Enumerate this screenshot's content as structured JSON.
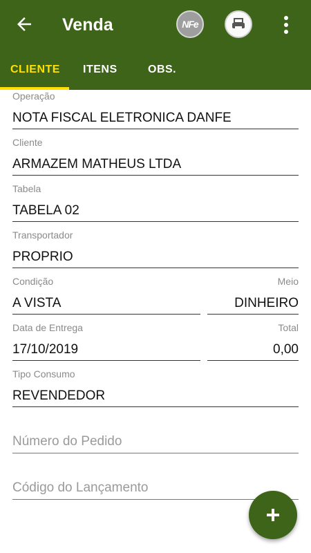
{
  "appbar": {
    "title": "Venda",
    "nfe_label": "NFe",
    "color": "#3d6419",
    "tab_active_color": "#ffe000"
  },
  "tabs": [
    {
      "label": "CLIENTE",
      "active": true
    },
    {
      "label": "ITENS",
      "active": false
    },
    {
      "label": "OBS.",
      "active": false
    }
  ],
  "form": {
    "operacao": {
      "label": "Operação",
      "value": "NOTA FISCAL ELETRONICA DANFE"
    },
    "cliente": {
      "label": "Cliente",
      "value": "ARMAZEM MATHEUS LTDA"
    },
    "tabela": {
      "label": "Tabela",
      "value": "TABELA 02"
    },
    "transportador": {
      "label": "Transportador",
      "value": "PROPRIO"
    },
    "condicao": {
      "label": "Condição",
      "value": "A VISTA"
    },
    "meio": {
      "label": "Meio",
      "value": "DINHEIRO"
    },
    "data_entrega": {
      "label": "Data de Entrega",
      "value": "17/10/2019"
    },
    "total": {
      "label": "Total",
      "value": "0,00"
    },
    "tipo_consumo": {
      "label": "Tipo Consumo",
      "value": "REVENDEDOR"
    },
    "numero_pedido": {
      "placeholder": "Número do Pedido"
    },
    "codigo_lancamento": {
      "placeholder": "Código do Lançamento"
    }
  },
  "icons": {
    "back": "arrow-left-icon",
    "nfe": "nfe-icon",
    "print": "printer-icon",
    "more": "more-vert-icon",
    "fab": "plus-icon"
  }
}
